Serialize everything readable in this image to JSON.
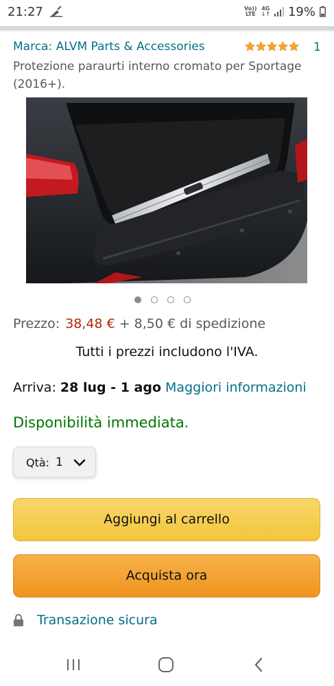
{
  "status_bar": {
    "time": "21:27",
    "left_icon": "broom-notification-icon",
    "volte_line1": "Vo))",
    "volte_line2": "LTE",
    "network": "4G",
    "battery": "19%"
  },
  "product": {
    "brand_link": "Marca: ALVM Parts & Accessories",
    "rating_stars": 5,
    "rating_count": "1",
    "title": "Protezione paraurti interno cromato per Sportage (2016+).",
    "image_icon": "car-trunk-photo",
    "carousel": {
      "total": 4,
      "active_index": 0
    }
  },
  "pricing": {
    "label": "Prezzo:",
    "value": "38,48 €",
    "shipping": "+ 8,50 € di spedizione",
    "vat_note": "Tutti i prezzi includono l'IVA."
  },
  "delivery": {
    "label": "Arriva:",
    "date": "28 lug - 1 ago",
    "more_info_link": "Maggiori informazioni"
  },
  "availability": "Disponibilità immediata.",
  "quantity": {
    "label": "Qtà:",
    "value": "1"
  },
  "buttons": {
    "add_to_cart": "Aggiungi al carrello",
    "buy_now": "Acquista ora"
  },
  "secure_transaction": "Transazione sicura",
  "colors": {
    "link": "#007185",
    "price": "#b12704",
    "in_stock": "#007600",
    "cart_button": "#f3c63b",
    "buy_button": "#f0941f"
  }
}
